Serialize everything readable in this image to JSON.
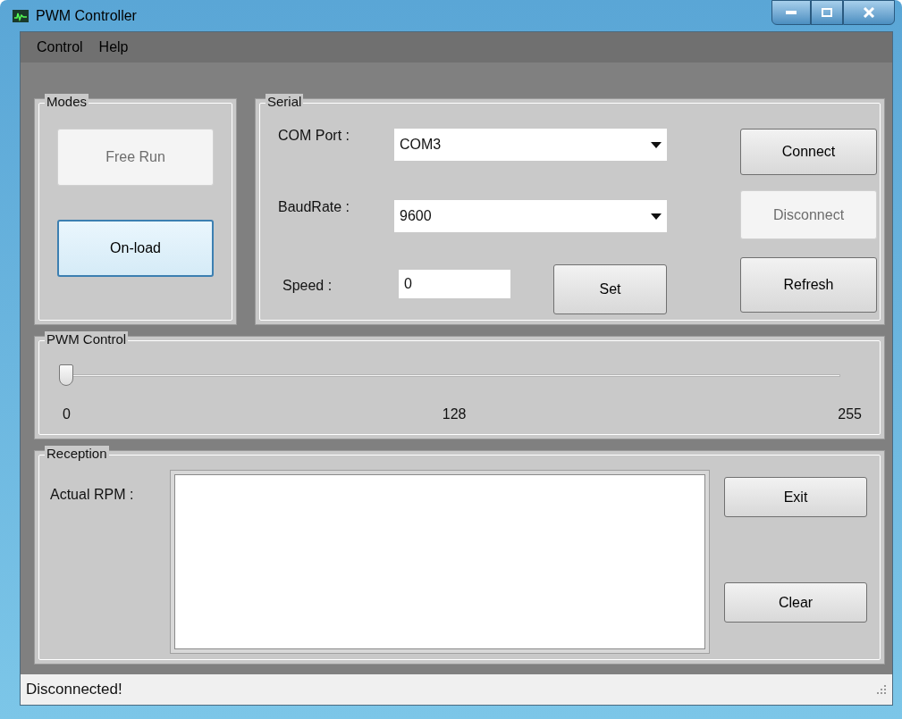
{
  "window": {
    "title": "PWM Controller"
  },
  "menu": [
    {
      "label": "Control"
    },
    {
      "label": "Help"
    }
  ],
  "modes": {
    "title": "Modes",
    "buttons": [
      {
        "label": "Free Run",
        "disabled": true,
        "focused": false
      },
      {
        "label": "On-load",
        "disabled": false,
        "focused": true
      }
    ]
  },
  "serial": {
    "title": "Serial",
    "com_port": {
      "label": "COM Port :",
      "value": "COM3"
    },
    "baud_rate": {
      "label": "BaudRate :",
      "value": "9600"
    },
    "speed": {
      "label": "Speed :",
      "value": "0"
    },
    "set_button": "Set",
    "buttons": [
      {
        "label": "Connect",
        "disabled": false
      },
      {
        "label": "Disconnect",
        "disabled": true
      },
      {
        "label": "Refresh",
        "disabled": false
      }
    ]
  },
  "pwm_control": {
    "title": "PWM Control",
    "level": 0,
    "ticks": [
      "0",
      "128",
      "255"
    ]
  },
  "reception": {
    "title": "Reception",
    "label": "Actual RPM :",
    "buttons": [
      "Exit",
      "Clear"
    ]
  },
  "status_bar": "Disconnected!"
}
